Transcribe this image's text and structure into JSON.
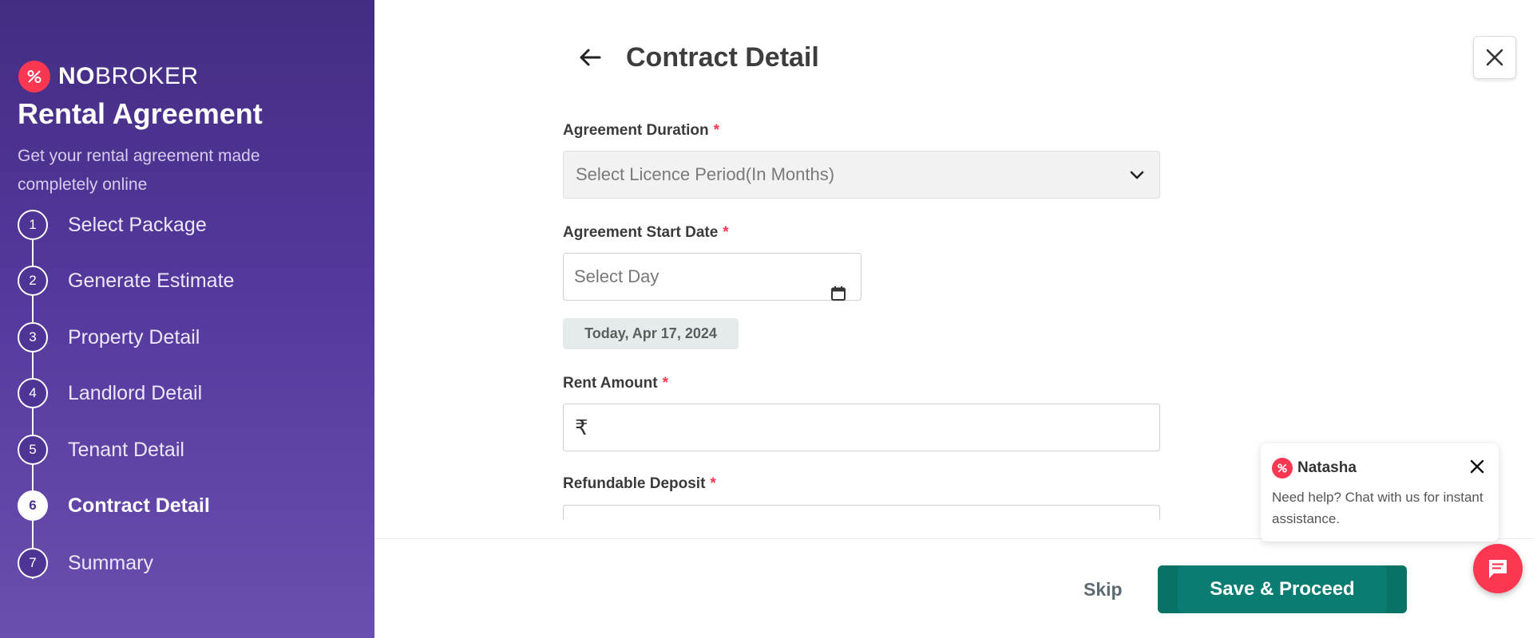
{
  "brand": {
    "bold": "NO",
    "light": "BROKER"
  },
  "sidebar": {
    "title": "Rental Agreement",
    "subtitle": "Get your rental agreement made completely online",
    "steps": [
      {
        "num": "1",
        "label": "Select Package"
      },
      {
        "num": "2",
        "label": "Generate Estimate"
      },
      {
        "num": "3",
        "label": "Property Detail"
      },
      {
        "num": "4",
        "label": "Landlord Detail"
      },
      {
        "num": "5",
        "label": "Tenant Detail"
      },
      {
        "num": "6",
        "label": "Contract Detail"
      },
      {
        "num": "7",
        "label": "Summary"
      }
    ],
    "active_step": "6"
  },
  "header": {
    "title": "Contract Detail"
  },
  "form": {
    "duration": {
      "label": "Agreement Duration",
      "required": "*",
      "placeholder": "Select Licence Period(In Months)"
    },
    "start_date": {
      "label": "Agreement Start Date",
      "required": "*",
      "placeholder": "Select Day",
      "today_chip": "Today, Apr 17, 2024"
    },
    "rent": {
      "label": "Rent Amount",
      "required": "*",
      "currency": "₹",
      "value": ""
    },
    "deposit": {
      "label": "Refundable Deposit",
      "required": "*",
      "currency": "₹",
      "value": ""
    }
  },
  "footer": {
    "skip_label": "Skip",
    "proceed_label": "Save & Proceed"
  },
  "chat": {
    "name": "Natasha",
    "message": "Need help? Chat with us for instant assistance."
  },
  "colors": {
    "brand_red": "#fd3752",
    "primary_green": "#0a7d73",
    "sidebar_purple": "#4a3090"
  }
}
